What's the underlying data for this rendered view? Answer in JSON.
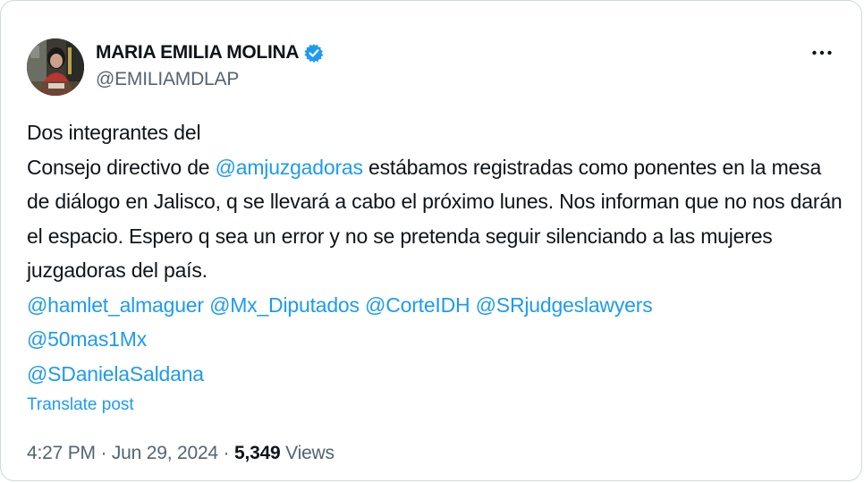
{
  "author": {
    "display_name": "MARIA EMILIA MOLINA",
    "handle": "@EMILIAMDLAP",
    "verified_icon": "verified-badge-icon",
    "avatar_icon": "avatar-photo"
  },
  "menu": {
    "more_icon": "more-options-icon"
  },
  "post": {
    "line1": "Dos integrantes del",
    "line2_pre": "Consejo directivo de ",
    "mention_amjuzgadoras": "@amjuzgadoras",
    "line2_post": "  estábamos registradas como ponentes en la mesa de diálogo en Jalisco, q se llevará a cabo el próximo lunes.  Nos informan que no nos darán el espacio. Espero q sea un error y no se pretenda seguir silenciando a las mujeres juzgadoras del país.",
    "mention_hamlet": "@hamlet_almaguer",
    "mention_diputados": "@Mx_Diputados",
    "mention_corteidh": "@CorteIDH",
    "mention_srjudges": "@SRjudgeslawyers",
    "mention_50mas1": "@50mas1Mx",
    "mention_saldana": "@SDanielaSaldana"
  },
  "translate_label": "Translate post",
  "meta": {
    "time": "4:27 PM",
    "sep1": " · ",
    "date": "Jun 29, 2024",
    "sep2": " · ",
    "views_count": "5,349",
    "views_label": " Views"
  },
  "colors": {
    "link": "#1d9bf0",
    "text": "#0f1419",
    "muted": "#536471",
    "border": "#cfd9de"
  }
}
